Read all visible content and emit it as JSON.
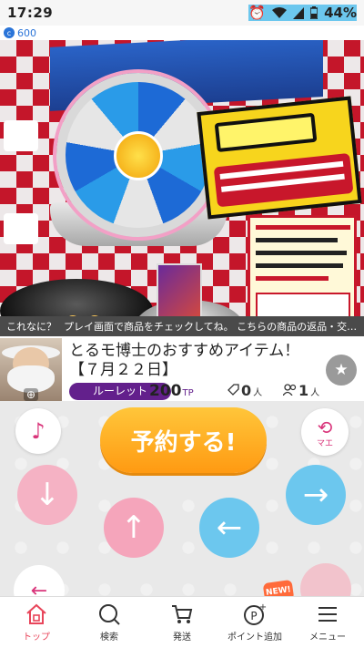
{
  "status": {
    "time": "17:29",
    "battery": "44%",
    "icons": [
      "alarm-icon",
      "wifi-icon",
      "signal-icon",
      "battery-icon"
    ]
  },
  "coins": {
    "value": "600"
  },
  "ticker": {
    "question": "これなに？",
    "message": "プレイ画面で商品をチェックしてね。 こちらの商品の返品・交…"
  },
  "machine": {
    "title_line1": "とるモ博士のおすすめアイテム！",
    "title_line2": "【７月２２日】",
    "category": "ルーレット",
    "price": "200",
    "price_unit": "TP",
    "watchers": "0",
    "watchers_unit": "人",
    "players": "1",
    "players_unit": "人"
  },
  "controls": {
    "reserve_label": "予約する!",
    "camera_label": "マエ",
    "new_badge": "NEW!"
  },
  "nav": {
    "items": [
      {
        "label": "トップ",
        "icon": "home-icon"
      },
      {
        "label": "検索",
        "icon": "search-icon"
      },
      {
        "label": "発送",
        "icon": "cart-icon"
      },
      {
        "label": "ポイント追加",
        "icon": "points-icon"
      },
      {
        "label": "メニュー",
        "icon": "menu-icon"
      }
    ]
  },
  "colors": {
    "accent_pink": "#e8455a",
    "category_purple": "#63208c",
    "reserve_orange": "#ff9a12",
    "arrow_blue": "#6cc7ee",
    "arrow_pink": "#f5b2c4"
  }
}
